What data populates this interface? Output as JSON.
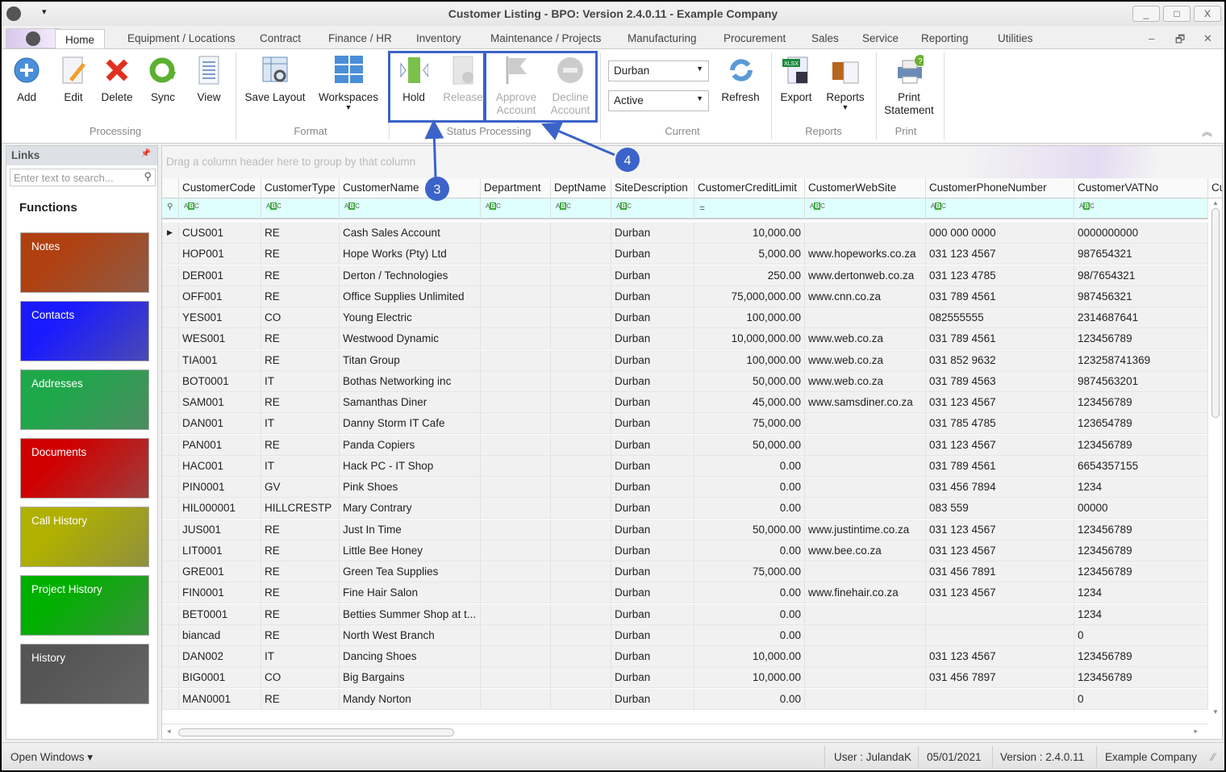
{
  "window": {
    "title": "Customer Listing - BPO: Version 2.4.0.11 - Example Company",
    "min": "_",
    "max": "□",
    "close": "X"
  },
  "tabs": [
    "Home",
    "Equipment / Locations",
    "Contract",
    "Finance / HR",
    "Inventory",
    "Maintenance / Projects",
    "Manufacturing",
    "Procurement",
    "Sales",
    "Service",
    "Reporting",
    "Utilities"
  ],
  "ribbon": {
    "processing": {
      "label": "Processing",
      "add": "Add",
      "edit": "Edit",
      "delete": "Delete",
      "sync": "Sync",
      "view": "View"
    },
    "format": {
      "label": "Format",
      "save_layout": "Save Layout",
      "workspaces": "Workspaces"
    },
    "status_processing": {
      "label": "Status Processing",
      "hold": "Hold",
      "release": "Release",
      "approve": "Approve Account",
      "decline": "Decline Account"
    },
    "current": {
      "label": "Current",
      "location": "Durban",
      "status": "Active",
      "refresh": "Refresh"
    },
    "reports": {
      "label": "Reports",
      "export": "Export",
      "reports": "Reports",
      "xlsx": "XLSX"
    },
    "print": {
      "label": "Print",
      "print_statement": "Print Statement"
    }
  },
  "annotations": {
    "a3": "3",
    "a4": "4"
  },
  "links": {
    "title": "Links",
    "search_placeholder": "Enter text to search...",
    "functions": "Functions",
    "tiles": [
      {
        "label": "Notes",
        "color": "#b04010"
      },
      {
        "label": "Contacts",
        "color": "#1a1aff"
      },
      {
        "label": "Addresses",
        "color": "#1ea84a"
      },
      {
        "label": "Documents",
        "color": "#d00000"
      },
      {
        "label": "Call History",
        "color": "#b0b000"
      },
      {
        "label": "Project History",
        "color": "#00b000"
      },
      {
        "label": "History",
        "color": "#555555"
      }
    ]
  },
  "grid": {
    "group_hint": "Drag a column header here to group by that column",
    "columns": [
      "CustomerCode",
      "CustomerType",
      "CustomerName",
      "Department",
      "DeptName",
      "SiteDescription",
      "CustomerCreditLimit",
      "CustomerWebSite",
      "CustomerPhoneNumber",
      "CustomerVATNo",
      "Cu"
    ],
    "rows": [
      [
        "CUS001",
        "RE",
        "Cash Sales Account",
        "",
        "",
        "Durban",
        "10,000.00",
        "",
        "000 000 0000",
        "0000000000"
      ],
      [
        "HOP001",
        "RE",
        "Hope Works (Pty) Ltd",
        "",
        "",
        "Durban",
        "5,000.00",
        "www.hopeworks.co.za",
        "031 123 4567",
        "987654321"
      ],
      [
        "DER001",
        "RE",
        "Derton / Technologies",
        "",
        "",
        "Durban",
        "250.00",
        "www.dertonweb.co.za",
        "031 123 4785",
        "98/7654321"
      ],
      [
        "OFF001",
        "RE",
        "Office Supplies Unlimited",
        "",
        "",
        "Durban",
        "75,000,000.00",
        "www.cnn.co.za",
        "031 789 4561",
        "987456321"
      ],
      [
        "YES001",
        "CO",
        "Young Electric",
        "",
        "",
        "Durban",
        "100,000.00",
        "",
        "082555555",
        "2314687641"
      ],
      [
        "WES001",
        "RE",
        "Westwood Dynamic",
        "",
        "",
        "Durban",
        "10,000,000.00",
        "www.web.co.za",
        "031 789 4561",
        "123456789"
      ],
      [
        "TIA001",
        "RE",
        "Titan Group",
        "",
        "",
        "Durban",
        "100,000.00",
        "www.web.co.za",
        "031 852 9632",
        "123258741369"
      ],
      [
        "BOT0001",
        "IT",
        "Bothas Networking inc",
        "",
        "",
        "Durban",
        "50,000.00",
        "www.web.co.za",
        "031 789 4563",
        "9874563201"
      ],
      [
        "SAM001",
        "RE",
        "Samanthas Diner",
        "",
        "",
        "Durban",
        "45,000.00",
        "www.samsdiner.co.za",
        "031 123 4567",
        "123456789"
      ],
      [
        "DAN001",
        "IT",
        "Danny Storm IT Cafe",
        "",
        "",
        "Durban",
        "75,000.00",
        "",
        "031 785 4785",
        "123654789"
      ],
      [
        "PAN001",
        "RE",
        "Panda Copiers",
        "",
        "",
        "Durban",
        "50,000.00",
        "",
        "031 123 4567",
        "123456789"
      ],
      [
        "HAC001",
        "IT",
        "Hack PC - IT Shop",
        "",
        "",
        "Durban",
        "0.00",
        "",
        "031 789 4561",
        "6654357155"
      ],
      [
        "PIN0001",
        "GV",
        "Pink Shoes",
        "",
        "",
        "Durban",
        "0.00",
        "",
        "031 456 7894",
        "1234"
      ],
      [
        "HIL000001",
        "HILLCRESTP",
        "Mary Contrary",
        "",
        "",
        "Durban",
        "0.00",
        "",
        "083 559",
        "00000"
      ],
      [
        "JUS001",
        "RE",
        "Just In Time",
        "",
        "",
        "Durban",
        "50,000.00",
        "www.justintime.co.za",
        "031 123 4567",
        "123456789"
      ],
      [
        "LIT0001",
        "RE",
        "Little Bee Honey",
        "",
        "",
        "Durban",
        "0.00",
        "www.bee.co.za",
        "031 123 4567",
        "123456789"
      ],
      [
        "GRE001",
        "RE",
        "Green Tea Supplies",
        "",
        "",
        "Durban",
        "75,000.00",
        "",
        "031 456 7891",
        "123456789"
      ],
      [
        "FIN0001",
        "RE",
        "Fine Hair Salon",
        "",
        "",
        "Durban",
        "0.00",
        "www.finehair.co.za",
        "031 123 4567",
        "1234"
      ],
      [
        "BET0001",
        "RE",
        "Betties Summer Shop at t...",
        "",
        "",
        "Durban",
        "0.00",
        "",
        "",
        "1234"
      ],
      [
        "biancad",
        "RE",
        "North West Branch",
        "",
        "",
        "Durban",
        "0.00",
        "",
        "",
        "0"
      ],
      [
        "DAN002",
        "IT",
        "Dancing Shoes",
        "",
        "",
        "Durban",
        "10,000.00",
        "",
        "031 123 4567",
        "123456789"
      ],
      [
        "BIG0001",
        "CO",
        "Big Bargains",
        "",
        "",
        "Durban",
        "10,000.00",
        "",
        "031 456 7897",
        "123456789"
      ],
      [
        "MAN0001",
        "RE",
        "Mandy Norton",
        "",
        "",
        "Durban",
        "0.00",
        "",
        "",
        "0"
      ]
    ]
  },
  "status": {
    "open_windows": "Open Windows ▾",
    "user": "User : JulandaK",
    "date": "05/01/2021",
    "version": "Version : 2.4.0.11",
    "company": "Example Company"
  }
}
